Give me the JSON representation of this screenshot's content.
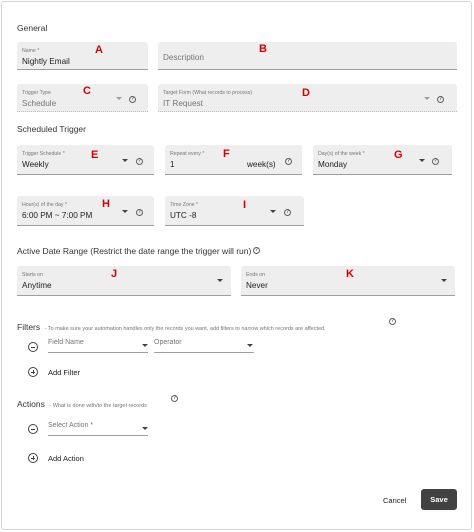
{
  "sections": {
    "general": "General",
    "scheduled_trigger": "Scheduled Trigger",
    "active_date_range": "Active Date Range (Restrict the date range the trigger will run)",
    "filters": "Filters",
    "filters_hint": "- To make sure your automation handles only the records you want, add filters to narrow which records are affected.",
    "actions": "Actions",
    "actions_hint": "- What is done with/to the target records"
  },
  "fields": {
    "name": {
      "label": "Name *",
      "value": "Nightly Email"
    },
    "description": {
      "placeholder": "Description"
    },
    "trigger_type": {
      "label": "Trigger Type",
      "value": "Schedule"
    },
    "target_form": {
      "label": "Target Form (What records to process)",
      "value": "IT Request"
    },
    "trigger_schedule": {
      "label": "Trigger Schedule *",
      "value": "Weekly"
    },
    "repeat_every": {
      "label": "Repeat every *",
      "value": "1",
      "unit": "week(s)"
    },
    "days_of_week": {
      "label": "Day(s) of the week *",
      "value": "Monday"
    },
    "hours_of_day": {
      "label": "Hour(s) of the day *",
      "value": "6:00 PM ~ 7:00 PM"
    },
    "time_zone": {
      "label": "Time Zone *",
      "value": "UTC -8"
    },
    "starts_on": {
      "label": "Starts on",
      "value": "Anytime"
    },
    "ends_on": {
      "label": "Ends on",
      "value": "Never"
    }
  },
  "filter_row": {
    "field_name": "Field Name",
    "operator": "Operator"
  },
  "add_filter": "Add Filter",
  "action_row": {
    "select_action": "Select Action *"
  },
  "add_action": "Add Action",
  "footer": {
    "cancel": "Cancel",
    "save": "Save"
  },
  "markers": {
    "a": "A",
    "b": "B",
    "c": "C",
    "d": "D",
    "e": "E",
    "f": "F",
    "g": "G",
    "h": "H",
    "i": "I",
    "j": "J",
    "k": "K"
  },
  "help_glyph": "?",
  "colors": {
    "marker": "#d50000",
    "field_bg": "#eeeeee",
    "save_bg": "#424242"
  }
}
